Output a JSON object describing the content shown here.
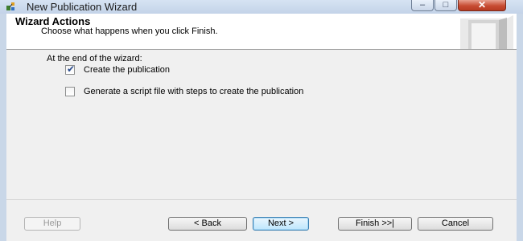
{
  "window": {
    "title": "New Publication Wizard",
    "icon": "wizard-app-icon",
    "controls": {
      "minimize": "–",
      "maximize": "□",
      "close": "✕"
    }
  },
  "header": {
    "title": "Wizard Actions",
    "subtitle": "Choose what happens when you click Finish.",
    "graphic": "wizard-banner-graphic"
  },
  "body": {
    "section_label": "At the end of the wizard:",
    "options": [
      {
        "label": "Create the publication",
        "checked": true,
        "check_glyph": "✔"
      },
      {
        "label": "Generate a script file with steps to create the publication",
        "checked": false,
        "check_glyph": ""
      }
    ]
  },
  "buttons": {
    "help": "Help",
    "back": "< Back",
    "next": "Next >",
    "finish": "Finish >>|",
    "cancel": "Cancel"
  },
  "colors": {
    "frame": "#c9d7e8",
    "client": "#f0f0f0",
    "header_bg": "#ffffff",
    "close_button": "#c74c33",
    "default_button_border": "#3c7fb1"
  }
}
